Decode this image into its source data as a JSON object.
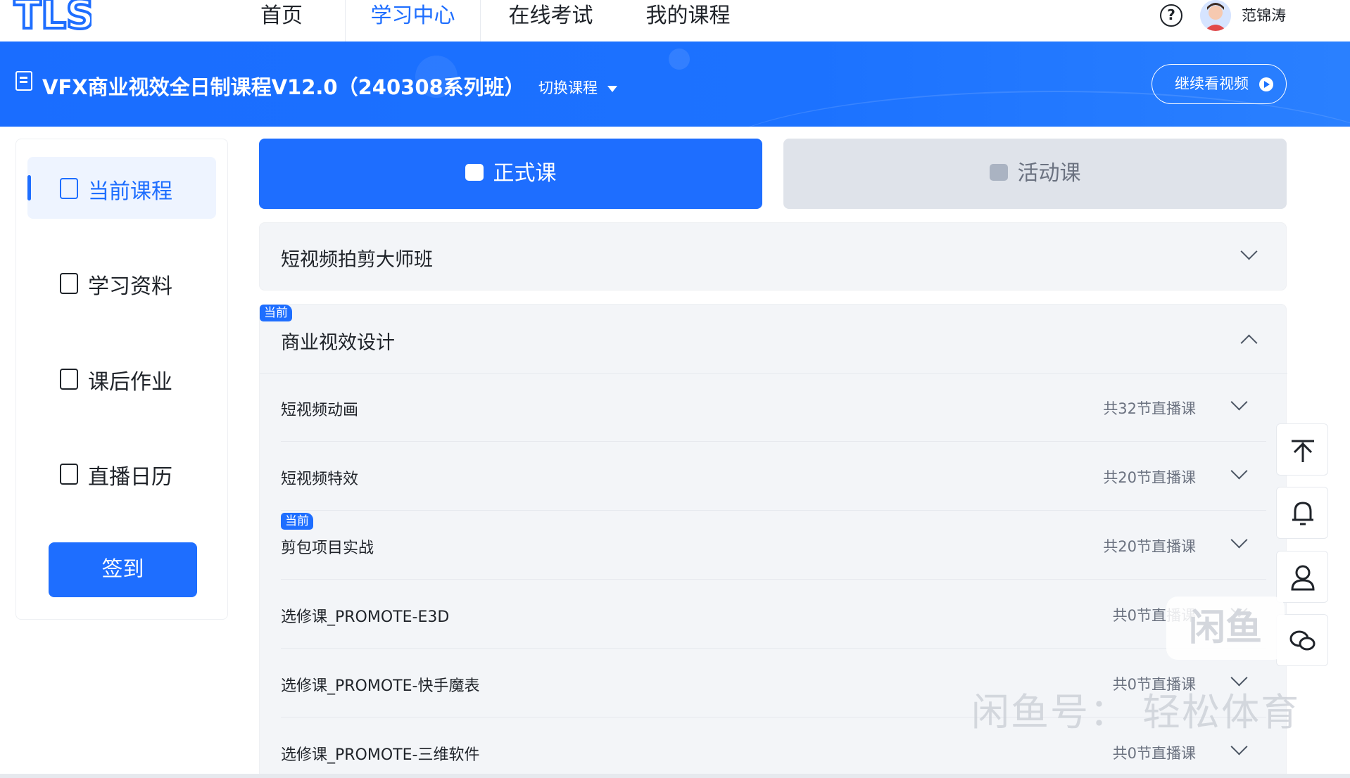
{
  "nav": {
    "logo_text": "TLS",
    "items": [
      "首页",
      "学习中心",
      "在线考试",
      "我的课程"
    ],
    "active_index": 1,
    "help_icon": "?",
    "username": "范锦涛"
  },
  "banner": {
    "course_title": "VFX商业视效全日制课程V12.0（240308系列班）",
    "switch_label": "切换课程",
    "continue_label": "继续看视频"
  },
  "sidebar": {
    "items": [
      "当前课程",
      "学习资料",
      "课后作业",
      "直播日历"
    ],
    "active_index": 0,
    "signin_label": "签到"
  },
  "tabs": {
    "formal": "正式课",
    "activity": "活动课"
  },
  "sections": [
    {
      "title": "短视频拍剪大师班",
      "expanded": false
    },
    {
      "title": "商业视效设计",
      "badge": "当前",
      "expanded": true,
      "subs": [
        {
          "name": "短视频动画",
          "count": "共32节直播课"
        },
        {
          "name": "短视频特效",
          "count": "共20节直播课"
        },
        {
          "name": "剪包项目实战",
          "count": "共20节直播课",
          "badge": "当前"
        },
        {
          "name": "选修课_PROMOTE-E3D",
          "count": "共0节直播课"
        },
        {
          "name": "选修课_PROMOTE-快手魔表",
          "count": "共0节直播课"
        },
        {
          "name": "选修课_PROMOTE-三维软件",
          "count": "共0节直播课"
        }
      ]
    }
  ],
  "floatbar": {
    "icons": [
      "back-to-top-icon",
      "bell-icon",
      "user-icon",
      "wechat-icon"
    ]
  },
  "watermark": {
    "box": "闲鱼",
    "text": "闲鱼号：  轻松体育"
  },
  "colors": {
    "primary": "#1e6eff",
    "banner": "#1c72ff",
    "panel": "#f3f5f8"
  }
}
